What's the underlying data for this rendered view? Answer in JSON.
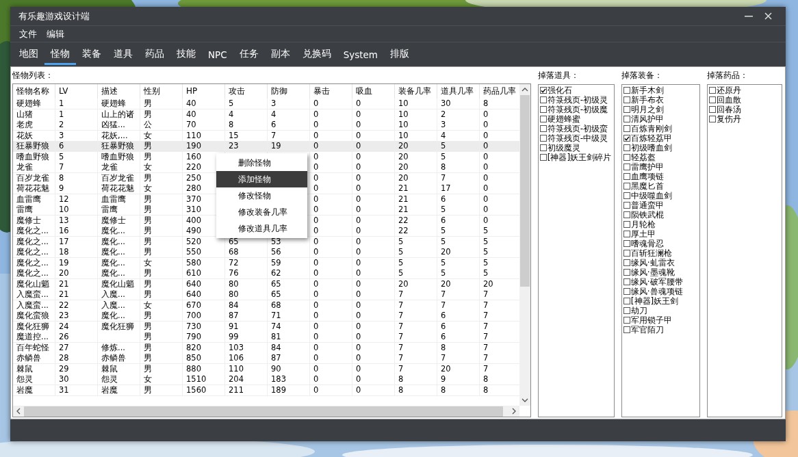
{
  "window": {
    "title": "有乐趣游戏设计端"
  },
  "menu": [
    "文件",
    "编辑"
  ],
  "tabs": [
    {
      "label": "地图",
      "selected": false
    },
    {
      "label": "怪物",
      "selected": true
    },
    {
      "label": "装备",
      "selected": false
    },
    {
      "label": "道具",
      "selected": false
    },
    {
      "label": "药品",
      "selected": false
    },
    {
      "label": "技能",
      "selected": false
    },
    {
      "label": "NPC",
      "selected": false
    },
    {
      "label": "任务",
      "selected": false
    },
    {
      "label": "副本",
      "selected": false
    },
    {
      "label": "兑换码",
      "selected": false
    },
    {
      "label": "System",
      "selected": false
    },
    {
      "label": "排版",
      "selected": false
    }
  ],
  "monster_list": {
    "label": "怪物列表：",
    "columns": [
      "怪物名称",
      "LV",
      "描述",
      "性别",
      "HP",
      "攻击",
      "防御",
      "暴击",
      "吸血",
      "装备几率",
      "道具几率",
      "药品几率"
    ],
    "rows": [
      {
        "cells": [
          "硬翅蜂",
          "1",
          "硬翅蜂",
          "男",
          "40",
          "5",
          "3",
          "0",
          "0",
          "10",
          "30",
          "8"
        ],
        "selected": false
      },
      {
        "cells": [
          "山猪",
          "1",
          "山上的诸",
          "男",
          "40",
          "4",
          "4",
          "0",
          "0",
          "10",
          "2",
          "0"
        ],
        "selected": false
      },
      {
        "cells": [
          "老虎",
          "2",
          "凶猛...",
          "公",
          "70",
          "8",
          "6",
          "0",
          "0",
          "10",
          "3",
          "0"
        ],
        "selected": false
      },
      {
        "cells": [
          "花妖",
          "3",
          "花妖,...",
          "女",
          "110",
          "15",
          "7",
          "0",
          "0",
          "10",
          "4",
          "0"
        ],
        "selected": false
      },
      {
        "cells": [
          "狂暴野狼",
          "6",
          "狂暴野狼",
          "男",
          "190",
          "23",
          "19",
          "0",
          "0",
          "20",
          "5",
          "0"
        ],
        "selected": true
      },
      {
        "cells": [
          "嗜血野狼",
          "5",
          "嗜血野狼",
          "男",
          "160",
          null,
          null,
          "0",
          "0",
          "20",
          "5",
          "0"
        ],
        "selected": false
      },
      {
        "cells": [
          "龙雀",
          "7",
          "龙雀",
          "女",
          "220",
          null,
          null,
          "0",
          "0",
          "20",
          "8",
          "0"
        ],
        "selected": false
      },
      {
        "cells": [
          "百岁龙雀",
          "8",
          "百岁龙雀",
          "男",
          "250",
          null,
          null,
          "0",
          "0",
          "20",
          "7",
          "0"
        ],
        "selected": false
      },
      {
        "cells": [
          "荷花花魅",
          "9",
          "荷花花魅",
          "女",
          "280",
          null,
          null,
          "0",
          "0",
          "21",
          "17",
          "0"
        ],
        "selected": false
      },
      {
        "cells": [
          "血雷鹰",
          "12",
          "血雷鹰",
          "男",
          "370",
          null,
          null,
          "0",
          "0",
          "21",
          "6",
          "0"
        ],
        "selected": false
      },
      {
        "cells": [
          "雷鹰",
          "10",
          "雷鹰",
          "男",
          "310",
          null,
          null,
          "0",
          "0",
          "21",
          "5",
          "0"
        ],
        "selected": false
      },
      {
        "cells": [
          "魔修士",
          "13",
          "魔修士",
          "男",
          "400",
          null,
          null,
          "0",
          "0",
          "22",
          "6",
          "0"
        ],
        "selected": false
      },
      {
        "cells": [
          "魔化之...",
          "16",
          "魔化...",
          "男",
          "490",
          null,
          null,
          "0",
          "0",
          "22",
          "5",
          "5"
        ],
        "selected": false
      },
      {
        "cells": [
          "魔化之...",
          "17",
          "魔化...",
          "男",
          "520",
          "65",
          "53",
          "0",
          "0",
          "5",
          "5",
          "5"
        ],
        "selected": false
      },
      {
        "cells": [
          "魔化之...",
          "18",
          "魔化...",
          "男",
          "550",
          "68",
          "56",
          "0",
          "0",
          "5",
          "20",
          "5"
        ],
        "selected": false
      },
      {
        "cells": [
          "魔化之...",
          "19",
          "魔化...",
          "女",
          "580",
          "72",
          "59",
          "0",
          "0",
          "5",
          "5",
          "5"
        ],
        "selected": false
      },
      {
        "cells": [
          "魔化之...",
          "20",
          "魔化...",
          "男",
          "610",
          "76",
          "62",
          "0",
          "0",
          "5",
          "5",
          "5"
        ],
        "selected": false
      },
      {
        "cells": [
          "魔化山魈",
          "21",
          "魔化山魈",
          "男",
          "640",
          "80",
          "65",
          "0",
          "0",
          "20",
          "20",
          "20"
        ],
        "selected": false
      },
      {
        "cells": [
          "入魔蛮...",
          "21",
          "入魔...",
          "男",
          "640",
          "80",
          "65",
          "0",
          "0",
          "7",
          "7",
          "7"
        ],
        "selected": false
      },
      {
        "cells": [
          "入魔蛮...",
          "22",
          "入魔...",
          "女",
          "670",
          "84",
          "68",
          "0",
          "0",
          "7",
          "7",
          "7"
        ],
        "selected": false
      },
      {
        "cells": [
          "魔化蛮狼",
          "23",
          "魔化...",
          "男",
          "700",
          "87",
          "71",
          "0",
          "0",
          "7",
          "6",
          "7"
        ],
        "selected": false
      },
      {
        "cells": [
          "魔化狂狮",
          "24",
          "魔化狂狮",
          "男",
          "730",
          "91",
          "74",
          "0",
          "0",
          "7",
          "6",
          "7"
        ],
        "selected": false
      },
      {
        "cells": [
          "魔道控...",
          "26",
          null,
          "男",
          "790",
          "99",
          "81",
          "0",
          "0",
          "7",
          "6",
          "7"
        ],
        "selected": false
      },
      {
        "cells": [
          "百年蛇怪",
          "27",
          "修炼...",
          "男",
          "820",
          "103",
          "84",
          "0",
          "0",
          "7",
          "8",
          "7"
        ],
        "selected": false
      },
      {
        "cells": [
          "赤鳞兽",
          "28",
          "赤鳞兽",
          "男",
          "850",
          "106",
          "87",
          "0",
          "0",
          "7",
          "7",
          "7"
        ],
        "selected": false
      },
      {
        "cells": [
          "棘鼠",
          "29",
          "棘鼠",
          "男",
          "880",
          "110",
          "90",
          "0",
          "0",
          "7",
          "20",
          "7"
        ],
        "selected": false
      },
      {
        "cells": [
          "怨灵",
          "30",
          "怨灵",
          "女",
          "1510",
          "204",
          "183",
          "0",
          "0",
          "8",
          "9",
          "8"
        ],
        "selected": false
      },
      {
        "cells": [
          "岩魔",
          "31",
          "岩魔",
          "男",
          "1560",
          "211",
          "189",
          "0",
          "0",
          "8",
          "8",
          "8"
        ],
        "selected": false
      }
    ]
  },
  "context_menu": [
    {
      "label": "删除怪物",
      "selected": false
    },
    {
      "label": "添加怪物",
      "selected": true
    },
    {
      "label": "修改怪物",
      "selected": false
    },
    {
      "label": "修改装备几率",
      "selected": false
    },
    {
      "label": "修改道具几率",
      "selected": false
    }
  ],
  "drop_panels": [
    {
      "label": "掉落道具：",
      "items": [
        {
          "label": "强化石",
          "checked": true
        },
        {
          "label": "符箓残页-初级灵",
          "checked": false
        },
        {
          "label": "符箓残页-初级魔",
          "checked": false
        },
        {
          "label": "硬翅蜂蜜",
          "checked": false
        },
        {
          "label": "符箓残页-初级蛮",
          "checked": false
        },
        {
          "label": "符箓残页-中级灵",
          "checked": false
        },
        {
          "label": "初级魔灵",
          "checked": false
        },
        {
          "label": "[神器]妖王剑碎片",
          "checked": false
        }
      ]
    },
    {
      "label": "掉落装备：",
      "items": [
        {
          "label": "新手木剑",
          "checked": false
        },
        {
          "label": "新手布衣",
          "checked": false
        },
        {
          "label": "明月之剑",
          "checked": false
        },
        {
          "label": "清风护甲",
          "checked": false
        },
        {
          "label": "百炼青刚剑",
          "checked": false
        },
        {
          "label": "百炼轻荔甲",
          "checked": true
        },
        {
          "label": "初级嗜血剑",
          "checked": false
        },
        {
          "label": "轻荔盔",
          "checked": false
        },
        {
          "label": "雷鹰护甲",
          "checked": false
        },
        {
          "label": "血鹰项链",
          "checked": false
        },
        {
          "label": "黑魔匕首",
          "checked": false
        },
        {
          "label": "中级噬血剑",
          "checked": false
        },
        {
          "label": "普通蛮甲",
          "checked": false
        },
        {
          "label": "陨铁武棍",
          "checked": false
        },
        {
          "label": "月轮枪",
          "checked": false
        },
        {
          "label": "厚土甲",
          "checked": false
        },
        {
          "label": "嗜魂骨忍",
          "checked": false
        },
        {
          "label": "百斩狂澜枪",
          "checked": false
        },
        {
          "label": "缘风·虬雷衣",
          "checked": false
        },
        {
          "label": "缘风·墨魂靴",
          "checked": false
        },
        {
          "label": "缘风·破军腰带",
          "checked": false
        },
        {
          "label": "缘风·兽魂项链",
          "checked": false
        },
        {
          "label": "[神器]妖王剑",
          "checked": false
        },
        {
          "label": "劫刀",
          "checked": false
        },
        {
          "label": "军用锁子甲",
          "checked": false
        },
        {
          "label": "军官陌刀",
          "checked": false
        }
      ]
    },
    {
      "label": "掉落药品：",
      "items": [
        {
          "label": "还原丹",
          "checked": false
        },
        {
          "label": "回血散",
          "checked": false
        },
        {
          "label": "回春汤",
          "checked": false
        },
        {
          "label": "复伤丹",
          "checked": false
        }
      ]
    }
  ]
}
